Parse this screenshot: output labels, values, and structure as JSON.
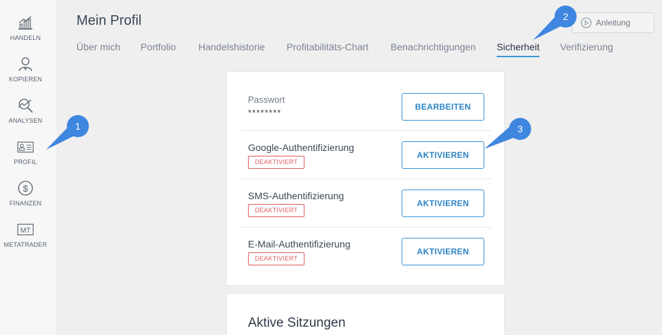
{
  "sidebar": {
    "items": [
      {
        "label": "HANDELN",
        "icon": "chart-icon"
      },
      {
        "label": "KOPIEREN",
        "icon": "person-icon"
      },
      {
        "label": "ANALYSEN",
        "icon": "analysis-icon"
      },
      {
        "label": "PROFIL",
        "icon": "id-card-icon"
      },
      {
        "label": "FINANZEN",
        "icon": "dollar-icon"
      },
      {
        "label": "METATRADER",
        "icon": "mt-icon",
        "glyph": "MT"
      }
    ]
  },
  "header": {
    "title": "Mein Profil",
    "guide_label": "Anleitung",
    "tabs": [
      {
        "label": "Über mich"
      },
      {
        "label": "Portfolio"
      },
      {
        "label": "Handelshistorie"
      },
      {
        "label": "Profitabilitäts-Chart"
      },
      {
        "label": "Benachrichtigungen"
      },
      {
        "label": "Sicherheit",
        "active": true
      },
      {
        "label": "Verifizierung"
      }
    ]
  },
  "security": {
    "password": {
      "label": "Passwort",
      "value": "********",
      "button": "BEARBEITEN"
    },
    "google": {
      "label": "Google-Authentifizierung",
      "status": "DEAKTIVIERT",
      "button": "AKTIVIEREN"
    },
    "sms": {
      "label": "SMS-Authentifizierung",
      "status": "DEAKTIVIERT",
      "button": "AKTIVIEREN"
    },
    "email": {
      "label": "E-Mail-Authentifizierung",
      "status": "DEAKTIVIERT",
      "button": "AKTIVIEREN"
    }
  },
  "sessions": {
    "title": "Aktive Sitzungen"
  },
  "callouts": [
    "1",
    "2",
    "3"
  ],
  "colors": {
    "accent": "#3a93d6",
    "callout": "#3e86e0",
    "danger": "#e05b5b"
  }
}
